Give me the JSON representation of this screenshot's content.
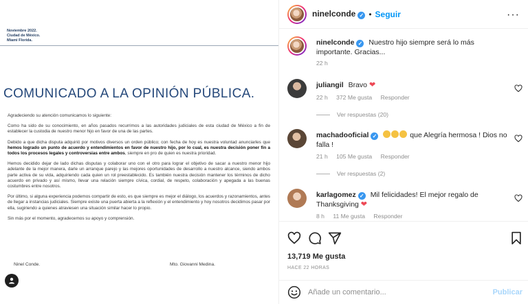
{
  "document": {
    "header_lines": [
      "Noviembre 2022.",
      "Ciudad de México.",
      "Miami Florida."
    ],
    "title": "COMUNICADO A LA OPINIÓN PÚBLICA.",
    "para1": "Agradeciendo su atención comunicamos lo siguiente:",
    "para2": "Como ha sido de su conocimiento, en años pasados recurrimos a las autoridades judiciales de esta ciudad de México a fin de establecer la custodia de nuestro menor hijo en favor de una de las partes.",
    "para3_a": "Debido a que dicha disputa adquirió por motivos diversos un orden público; con fecha de hoy es nuestra voluntad anunciarles que",
    "para3_bold": "hemos logrado un punto de acuerdo y entendimientos en favor de nuestro hijo, por lo cual, es nuestra decisión poner fin a todos los procesos legales y controversias entre ambos",
    "para3_c": ", siempre en pro de quien es nuestra prioridad.",
    "para4": "Hemos decidido dejar de lado dichas disputas y colaborar uno con el otro para lograr el objetivo de sacar a nuestro menor hijo adelante de la mejor manera, darle un arranque parejo y las mejores oportunidades de desarrollo a nuestro alcance, siendo ambos parte activa de su vida, adquiriendo cada quien un rol preestablecido. Es también nuestra decisión mantener los términos de dicho acuerdo en privado y así mismo, llevar una relación siempre cívica, cordial, de respeto, colaboración y apegada a las buenas costumbres entre nosotros.",
    "para5": "Por último, si alguna experiencia podemos compartir de esto, es que siempre es mejor el diálogo, los acuerdos y razonamientos, antes de llegar a instancias judiciales. Siempre existe una puerta abierta a la reflexión y el entendimiento y hoy nosotros decidimos pasar por ella, sugiriendo a quienes atraviesen una situación similar hacer lo propio.",
    "para6": "Sin más por el momento, agradecemos su apoyo y comprensión.",
    "sign_left": "Ninel Conde.",
    "sign_right": "Mto. Giovanni Medina."
  },
  "header": {
    "username": "ninelconde",
    "dot": "•",
    "follow_label": "Seguir",
    "more": "···"
  },
  "caption": {
    "username": "ninelconde",
    "text": "Nuestro hijo siempre será lo más importante. Gracias...",
    "time": "22 h"
  },
  "comments": [
    {
      "username": "juliangil",
      "text": "Bravo",
      "time": "22 h",
      "likes": "372 Me gusta",
      "reply": "Responder",
      "view_replies": "Ver respuestas (20)"
    },
    {
      "username": "machadooficial",
      "text": "que Alegría hermosa ! Dios no falla !",
      "time": "21 h",
      "likes": "105 Me gusta",
      "reply": "Responder",
      "view_replies": "Ver respuestas (2)"
    },
    {
      "username": "karlagomez",
      "text": "Mil felicidades! El mejor regalo de Thanksgiving",
      "time": "8 h",
      "likes": "11 Me gusta",
      "reply": "Responder"
    }
  ],
  "post": {
    "likes": "13,719 Me gusta",
    "time": "HACE 22 HORAS"
  },
  "add_comment": {
    "placeholder": "Añade un comentario...",
    "publish": "Publicar"
  },
  "colors": {
    "accent": "#0095f6",
    "heart": "#ed4956",
    "verified": "#3897f0",
    "title_blue": "#25487a"
  }
}
